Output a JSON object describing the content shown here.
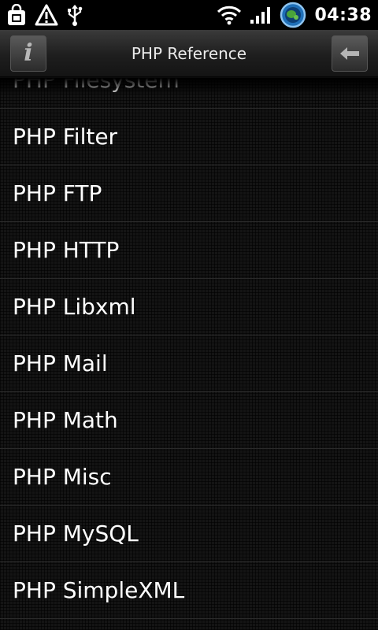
{
  "status_bar": {
    "time": "04:38",
    "icons": [
      "shopping-bag-icon",
      "warning-icon",
      "usb-icon",
      "wifi-icon",
      "signal-icon",
      "app-globe-icon"
    ]
  },
  "title_bar": {
    "title": "PHP Reference",
    "left_button_icon": "info-icon",
    "right_button_icon": "back-arrow-icon"
  },
  "list": {
    "items": [
      {
        "label": "PHP Filesystem"
      },
      {
        "label": "PHP Filter"
      },
      {
        "label": "PHP FTP"
      },
      {
        "label": "PHP HTTP"
      },
      {
        "label": "PHP Libxml"
      },
      {
        "label": "PHP Mail"
      },
      {
        "label": "PHP Math"
      },
      {
        "label": "PHP Misc"
      },
      {
        "label": "PHP MySQL"
      },
      {
        "label": "PHP SimpleXML"
      }
    ]
  },
  "colors": {
    "background": "#141414",
    "text": "#ffffff",
    "title_bar": "#2a2a2a"
  }
}
